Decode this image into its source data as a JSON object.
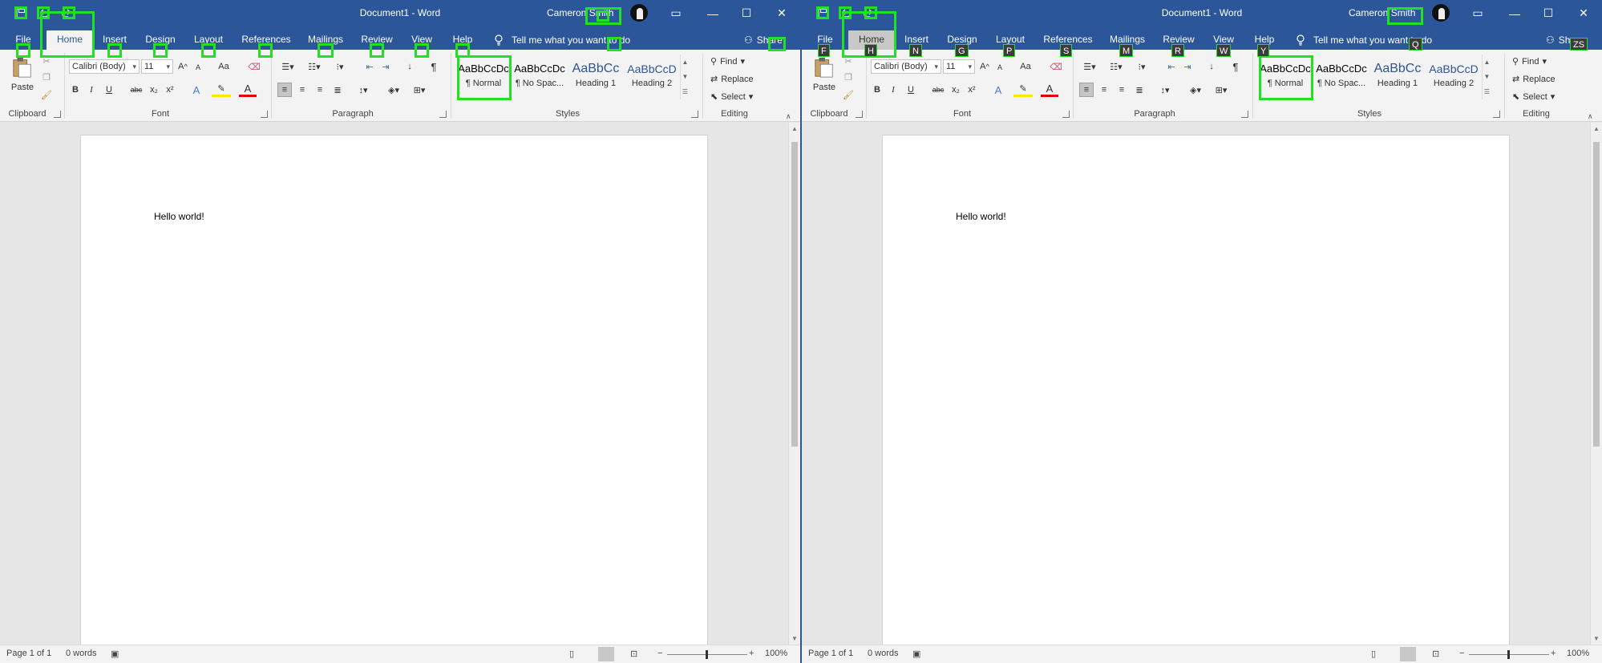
{
  "colors": {
    "title_bar": "#2b579a",
    "ribbon": "#f3f3f3",
    "overlay": "#22e022",
    "badge": "#3c3c3c"
  },
  "title_bar": {
    "doc_title": "Document1  -  Word",
    "user_name": "Cameron Smith",
    "qat_icons": [
      "save-icon",
      "undo-icon",
      "redo-icon"
    ],
    "window_controls": [
      "ribbon-display-icon",
      "minimize-icon",
      "maximize-icon",
      "close-icon"
    ]
  },
  "tabs": [
    "File",
    "Home",
    "Insert",
    "Design",
    "Layout",
    "References",
    "Mailings",
    "Review",
    "View",
    "Help"
  ],
  "tell_me": "Tell me what you want to do",
  "share": "Share",
  "share_short": "Sh",
  "ribbon": {
    "clipboard": {
      "label": "Clipboard",
      "paste": "Paste"
    },
    "font": {
      "label": "Font",
      "font_name": "Calibri (Body)",
      "font_size": "11",
      "change_case": "Aa",
      "bold": "B",
      "italic": "I",
      "underline": "U",
      "strike": "abc",
      "subscript": "x₂",
      "superscript": "x²"
    },
    "paragraph": {
      "label": "Paragraph",
      "pilcrow": "¶"
    },
    "styles": {
      "label": "Styles",
      "items": [
        {
          "sample": "AaBbCcDc",
          "name": "¶ Normal"
        },
        {
          "sample": "AaBbCcDc",
          "name": "¶ No Spac..."
        },
        {
          "sample": "AaBbCc",
          "name": "Heading 1"
        },
        {
          "sample": "AaBbCcD",
          "name": "Heading 2"
        }
      ]
    },
    "editing": {
      "label": "Editing",
      "find": "Find",
      "replace": "Replace",
      "select": "Select"
    }
  },
  "document": {
    "text": "Hello world!"
  },
  "status": {
    "page": "Page 1 of 1",
    "words": "0 words",
    "zoom": "100%",
    "zoom_minus": "−",
    "zoom_plus": "+"
  },
  "keytips": {
    "tabs": [
      "F",
      "H",
      "N",
      "G",
      "P",
      "S",
      "M",
      "R",
      "W",
      "Y"
    ],
    "tell_me": "Q",
    "share": "ZS"
  }
}
